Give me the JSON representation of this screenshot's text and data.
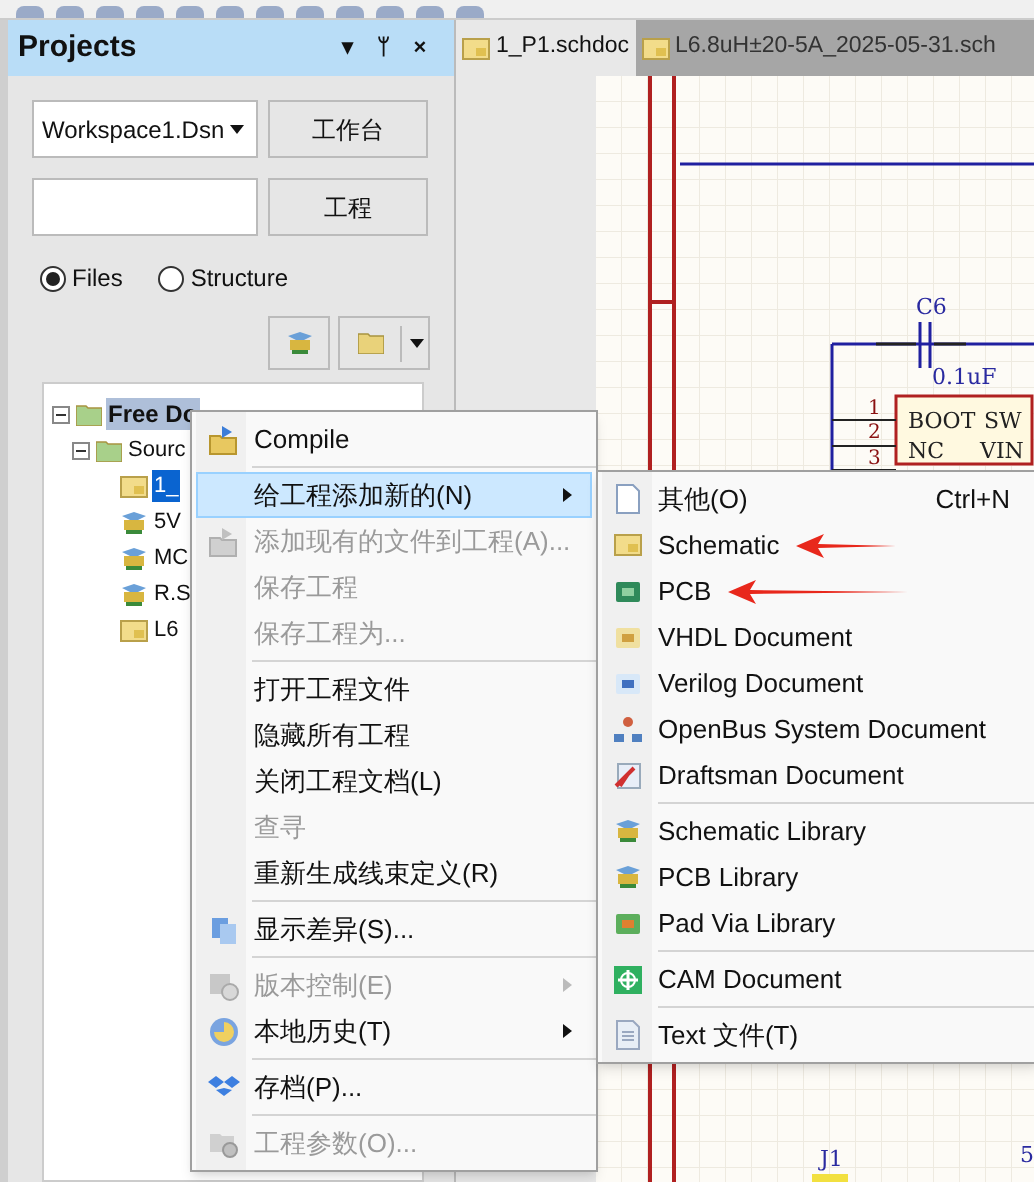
{
  "panel": {
    "title": "Projects",
    "header_icons": [
      "▾",
      "ᛘ",
      "×"
    ],
    "workspace": {
      "value": "Workspace1.Dsn",
      "button": "工作台"
    },
    "project": {
      "button": "工程"
    },
    "view_options": [
      {
        "label": "Files",
        "selected": true
      },
      {
        "label": "Structure",
        "selected": false
      }
    ],
    "tree": [
      {
        "label": "Free Do",
        "selected": true,
        "expanded": true,
        "children": [
          {
            "label": "Sourc",
            "selected": false,
            "expanded": true,
            "children": [
              {
                "label": "1_",
                "selected": true
              },
              {
                "label": "5V",
                "selected": false
              },
              {
                "label": "MC",
                "selected": false
              },
              {
                "label": "R.S",
                "selected": false
              },
              {
                "label": "L6",
                "selected": false
              }
            ]
          }
        ]
      }
    ]
  },
  "document_tabs": [
    {
      "label": "1_P1.schdoc",
      "selected": true
    },
    {
      "label": "L6.8uH±20-5A_2025-05-31.sch",
      "selected": false
    }
  ],
  "schematic": {
    "labels": [
      {
        "kind": "ref",
        "text": "C6"
      },
      {
        "kind": "value",
        "text": "0.1uF"
      },
      {
        "kind": "pin",
        "text": "BOOT"
      },
      {
        "kind": "pin",
        "text": "SW"
      },
      {
        "kind": "pin",
        "text": "NC"
      },
      {
        "kind": "pin",
        "text": "VIN"
      },
      {
        "kind": "pinnum",
        "text": "1"
      },
      {
        "kind": "pinnum",
        "text": "2"
      },
      {
        "kind": "pinnum",
        "text": "3"
      },
      {
        "kind": "ref",
        "text": "J1"
      },
      {
        "kind": "ref",
        "text": "5"
      }
    ]
  },
  "context_menu": [
    {
      "kind": "item",
      "label": "Compile",
      "disabled": false,
      "selected": false,
      "has_submenu": false
    },
    {
      "kind": "separator"
    },
    {
      "kind": "item",
      "label": "给工程添加新的(N)",
      "disabled": false,
      "selected": true,
      "has_submenu": true
    },
    {
      "kind": "item",
      "label": "添加现有的文件到工程(A)...",
      "disabled": true,
      "selected": false,
      "has_submenu": false
    },
    {
      "kind": "item",
      "label": "保存工程",
      "disabled": true,
      "selected": false,
      "has_submenu": false
    },
    {
      "kind": "item",
      "label": "保存工程为...",
      "disabled": true,
      "selected": false,
      "has_submenu": false
    },
    {
      "kind": "separator"
    },
    {
      "kind": "item",
      "label": "打开工程文件",
      "disabled": false,
      "selected": false,
      "has_submenu": false
    },
    {
      "kind": "item",
      "label": "隐藏所有工程",
      "disabled": false,
      "selected": false,
      "has_submenu": false
    },
    {
      "kind": "item",
      "label": "关闭工程文档(L)",
      "disabled": false,
      "selected": false,
      "has_submenu": false
    },
    {
      "kind": "item",
      "label": "查寻",
      "disabled": true,
      "selected": false,
      "has_submenu": false
    },
    {
      "kind": "item",
      "label": "重新生成线束定义(R)",
      "disabled": false,
      "selected": false,
      "has_submenu": false
    },
    {
      "kind": "separator"
    },
    {
      "kind": "item",
      "label": "显示差异(S)...",
      "disabled": false,
      "selected": false,
      "has_submenu": false
    },
    {
      "kind": "separator"
    },
    {
      "kind": "item",
      "label": "版本控制(E)",
      "disabled": true,
      "selected": false,
      "has_submenu": true
    },
    {
      "kind": "item",
      "label": "本地历史(T)",
      "disabled": false,
      "selected": false,
      "has_submenu": true
    },
    {
      "kind": "separator"
    },
    {
      "kind": "item",
      "label": "存档(P)...",
      "disabled": false,
      "selected": false,
      "has_submenu": false
    },
    {
      "kind": "separator"
    },
    {
      "kind": "item",
      "label": "工程参数(O)...",
      "disabled": true,
      "selected": false,
      "has_submenu": false
    }
  ],
  "submenu": [
    {
      "kind": "item",
      "label": "其他(O)",
      "shortcut": "Ctrl+N",
      "arrow": false
    },
    {
      "kind": "item",
      "label": "Schematic",
      "arrow": true
    },
    {
      "kind": "item",
      "label": "PCB",
      "arrow": true
    },
    {
      "kind": "item",
      "label": "VHDL Document",
      "arrow": false
    },
    {
      "kind": "item",
      "label": "Verilog Document",
      "arrow": false
    },
    {
      "kind": "item",
      "label": "OpenBus System Document",
      "arrow": false
    },
    {
      "kind": "item",
      "label": "Draftsman Document",
      "arrow": false
    },
    {
      "kind": "separator"
    },
    {
      "kind": "item",
      "label": "Schematic Library",
      "arrow": false
    },
    {
      "kind": "item",
      "label": "PCB Library",
      "arrow": false
    },
    {
      "kind": "item",
      "label": "Pad Via Library",
      "arrow": false
    },
    {
      "kind": "separator"
    },
    {
      "kind": "item",
      "label": "CAM Document",
      "arrow": false
    },
    {
      "kind": "separator"
    },
    {
      "kind": "item",
      "label": "Text  文件(T)",
      "arrow": false
    }
  ]
}
